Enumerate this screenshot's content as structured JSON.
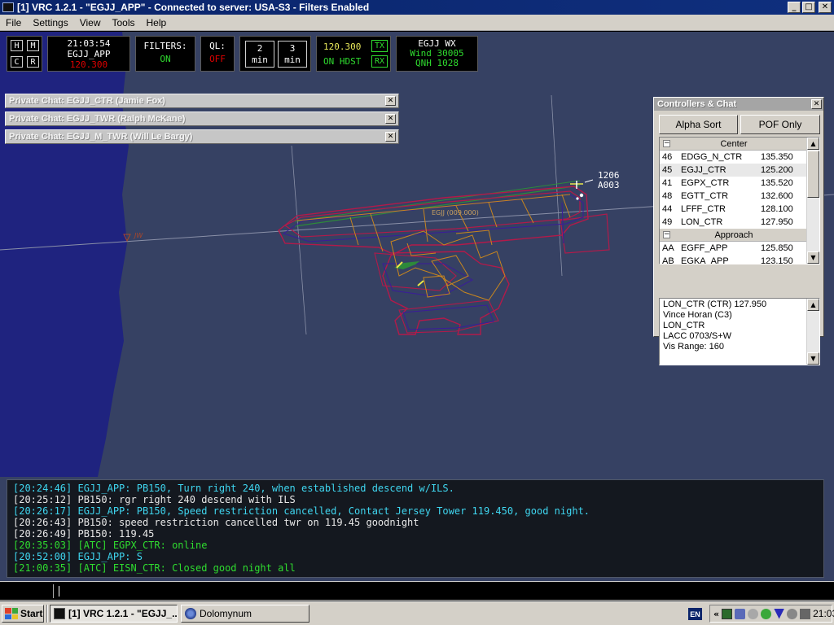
{
  "window": {
    "title": "[1] VRC 1.2.1 - \"EGJJ_APP\" - Connected to server: USA-S3 - Filters Enabled",
    "minimize": "_",
    "maximize": "□",
    "close": "✕"
  },
  "menu": {
    "file": "File",
    "settings": "Settings",
    "view": "View",
    "tools": "Tools",
    "help": "Help"
  },
  "toolbar": {
    "keys": {
      "h": "H",
      "m": "M",
      "c": "C",
      "r": "R"
    },
    "clock_time": "21:03:54",
    "clock_callsign": "EGJJ_APP",
    "clock_freq": "120.300",
    "filters_label": "FILTERS:",
    "filters_state": "ON",
    "ql_label": "QL:",
    "ql_state": "OFF",
    "min1_num": "2",
    "min1_unit": "min",
    "min2_num": "3",
    "min2_unit": "min",
    "radio_freq": "120.300",
    "radio_mode": "ON HDST",
    "tx": "TX",
    "rx": "RX",
    "wx_station": "EGJJ WX",
    "wx_wind": "Wind 30005",
    "wx_qnh": "QNH 1028"
  },
  "private_chats": [
    {
      "label": "Private Chat: EGJJ_CTR (Jamie Fox)",
      "close": "✕"
    },
    {
      "label": "Private Chat: EGJJ_TWR (Ralph McKane)",
      "close": "✕"
    },
    {
      "label": "Private Chat: EGJJ_M_TWR (Will Le Bargy)",
      "close": "✕"
    }
  ],
  "radar": {
    "aircraft_line1": "1206",
    "aircraft_line2": "A003",
    "fix_label": "JW",
    "runway_label": "EGJJ (009.000)"
  },
  "controllers_panel": {
    "title": "Controllers & Chat",
    "close": "✕",
    "alpha_sort": "Alpha Sort",
    "pof_only": "POF Only",
    "center_group": "Center",
    "approach_group": "Approach",
    "collapse": "−",
    "center": [
      {
        "id": "46",
        "callsign": "EDGG_N_CTR",
        "freq": "135.350"
      },
      {
        "id": "45",
        "callsign": "EGJJ_CTR",
        "freq": "125.200"
      },
      {
        "id": "41",
        "callsign": "EGPX_CTR",
        "freq": "135.520"
      },
      {
        "id": "48",
        "callsign": "EGTT_CTR",
        "freq": "132.600"
      },
      {
        "id": "44",
        "callsign": "LFFF_CTR",
        "freq": "128.100"
      },
      {
        "id": "49",
        "callsign": "LON_CTR",
        "freq": "127.950"
      }
    ],
    "approach": [
      {
        "id": "AA",
        "callsign": "EGFF_APP",
        "freq": "125.850"
      },
      {
        "id": "AB",
        "callsign": "EGKA_APP",
        "freq": "123.150"
      }
    ],
    "info": {
      "line1": "LON_CTR (CTR) 127.950",
      "line2": "Vince Horan (C3)",
      "line3": "LON_CTR",
      "line4": "LACC 0703/S+W",
      "line5": "Vis Range: 160"
    }
  },
  "messages": [
    {
      "text": "[20:24:46] EGJJ_APP: PB150, Turn right 240, when established descend w/ILS.",
      "color": "cyan"
    },
    {
      "text": "[20:25:12] PB150: rgr right 240 descend with ILS",
      "color": "white"
    },
    {
      "text": "[20:26:17] EGJJ_APP: PB150, Speed restriction cancelled, Contact Jersey Tower 119.450, good night.",
      "color": "cyan"
    },
    {
      "text": "[20:26:43] PB150: speed restriction cancelled twr on 119.45 goodnight",
      "color": "white"
    },
    {
      "text": "[20:26:49] PB150: 119.45",
      "color": "white"
    },
    {
      "text": "[20:35:03] [ATC] EGPX_CTR: online",
      "color": "green"
    },
    {
      "text": "[20:52:00] EGJJ_APP: S",
      "color": "cyan"
    },
    {
      "text": "[21:00:35] [ATC] EISN_CTR: Closed good night all",
      "color": "green"
    }
  ],
  "command_line": {
    "value": ""
  },
  "taskbar": {
    "start": "Start",
    "task_vrc": "[1] VRC 1.2.1 - \"EGJJ_...",
    "task_dolomynum": "Dolomynum",
    "lang": "EN",
    "chevron": "«",
    "time": "21:03"
  },
  "colors": {
    "radar_bg": "#364163",
    "sea": "#1f237f",
    "runway": "#2d8a3a",
    "taxiway": "#c8861e",
    "apron": "#b21a4a",
    "stand": "#3a1c9a"
  }
}
